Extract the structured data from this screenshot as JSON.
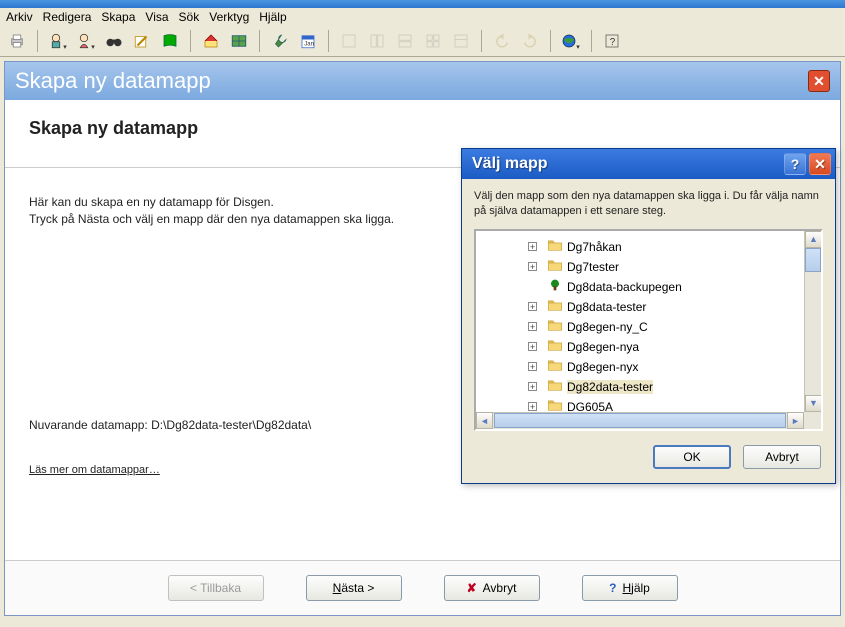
{
  "menubar": [
    "Arkiv",
    "Redigera",
    "Skapa",
    "Visa",
    "Sök",
    "Verktyg",
    "Hjälp"
  ],
  "inner": {
    "title": "Skapa ny datamapp",
    "heading": "Skapa ny datamapp",
    "text1": "Här kan du skapa en ny datamapp för Disgen.",
    "text2": "Tryck på Nästa och välj en mapp där den nya datamappen ska ligga.",
    "current_label": "Nuvarande datamapp: ",
    "current_path": "D:\\Dg82data-tester\\Dg82data\\",
    "link": "Läs mer om datamappar…"
  },
  "buttons": {
    "back": "< Tillbaka",
    "next_prefix": "N",
    "next_rest": "ästa >",
    "cancel": "Avbryt",
    "help_prefix": "H",
    "help_rest": "jälp"
  },
  "modal": {
    "title": "Välj mapp",
    "text": "Välj den mapp som den nya datamappen ska ligga i. Du får välja namn på själva datamappen i ett senare steg.",
    "ok": "OK",
    "cancel": "Avbryt",
    "items": [
      {
        "label": "Dg7håkan",
        "icon": "folder",
        "expandable": true
      },
      {
        "label": "Dg7tester",
        "icon": "folder",
        "expandable": true
      },
      {
        "label": "Dg8data-backupegen",
        "icon": "tree",
        "expandable": false
      },
      {
        "label": "Dg8data-tester",
        "icon": "folder",
        "expandable": true
      },
      {
        "label": "Dg8egen-ny_C",
        "icon": "folder",
        "expandable": true
      },
      {
        "label": "Dg8egen-nya",
        "icon": "folder",
        "expandable": true
      },
      {
        "label": "Dg8egen-nyx",
        "icon": "folder",
        "expandable": true
      },
      {
        "label": "Dg82data-tester",
        "icon": "folder",
        "expandable": true,
        "selected": true
      },
      {
        "label": "DG605A",
        "icon": "folder",
        "expandable": true
      }
    ]
  }
}
